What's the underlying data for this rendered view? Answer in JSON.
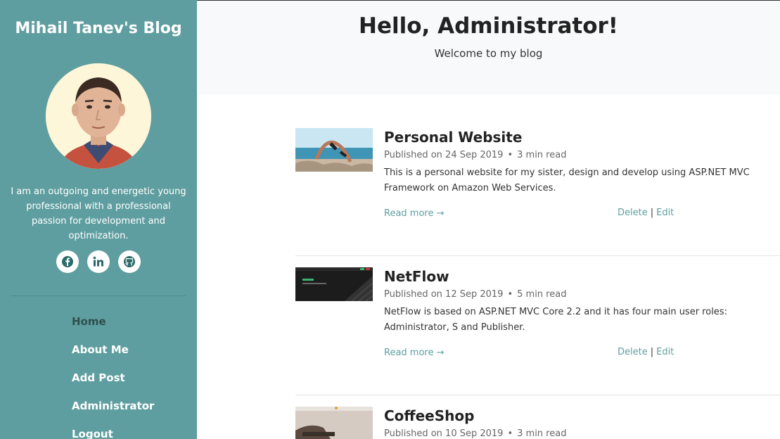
{
  "sidebar": {
    "title": "Mihail Tanev's Blog",
    "bio": "I am an outgoing and energetic young professional with a professional passion for development and optimization.",
    "social": [
      {
        "icon": "facebook-icon"
      },
      {
        "icon": "linkedin-icon"
      },
      {
        "icon": "github-icon"
      }
    ],
    "nav": [
      {
        "label": "Home",
        "active": true
      },
      {
        "label": "About Me"
      },
      {
        "label": "Add Post"
      },
      {
        "label": "Administrator"
      },
      {
        "label": "Logout"
      }
    ]
  },
  "header": {
    "title": "Hello, Administrator!",
    "subtitle": "Welcome to my blog"
  },
  "posts": [
    {
      "title": "Personal Website",
      "date": "Published on 24 Sep 2019",
      "read_time": "3 min read",
      "excerpt": "This is a personal website for my sister, design and develop using ASP.NET MVC Framework on Amazon Web Services.",
      "read_more": "Read more →",
      "delete": "Delete",
      "edit": "Edit"
    },
    {
      "title": "NetFlow",
      "date": "Published on 12 Sep 2019",
      "read_time": "5 min read",
      "excerpt": "NetFlow is based on ASP.NET MVC Core 2.2 and it has four main user roles: Administrator, S and Publisher.",
      "read_more": "Read more →",
      "delete": "Delete",
      "edit": "Edit"
    },
    {
      "title": "CoffeeShop",
      "date": "Published on 10 Sep 2019",
      "read_time": "3 min read"
    }
  ],
  "colors": {
    "sidebar": "#5f9ea0",
    "link": "#5f9ea0",
    "header_bg": "#f8f9fa"
  }
}
